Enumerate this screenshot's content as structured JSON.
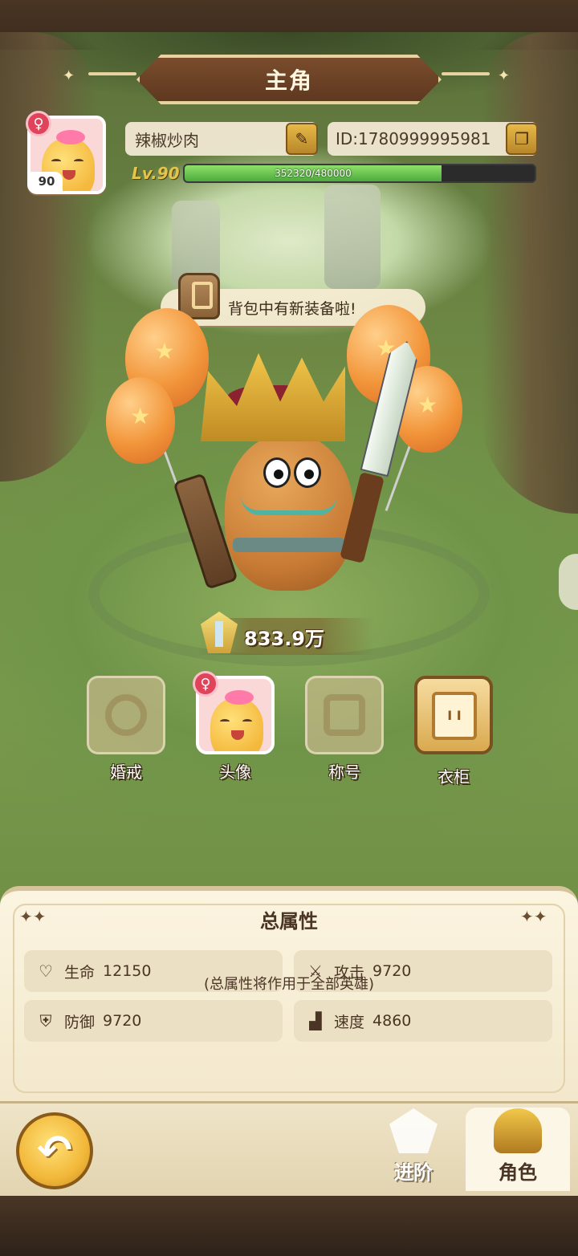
{
  "header": {
    "title": "主角"
  },
  "profile": {
    "name": "辣椒炒肉",
    "id_text": "ID:1780999995981",
    "level_badge": "90",
    "level_label": "Lv.90",
    "xp_text": "352320/480000",
    "xp_current": 352320,
    "xp_max": 480000,
    "gender_icon": "female-icon",
    "edit_icon": "pencil-icon",
    "copy_icon": "copy-icon"
  },
  "notice": {
    "text": "背包中有新装备啦!",
    "icon": "backpack-icon"
  },
  "power": {
    "value": "833.9万",
    "icon": "sword-badge-icon"
  },
  "features": [
    {
      "label": "婚戒",
      "state": "locked",
      "icon": "ring-icon"
    },
    {
      "label": "头像",
      "state": "unlocked",
      "icon": "avatar-icon"
    },
    {
      "label": "称号",
      "state": "locked",
      "icon": "title-crown-icon"
    },
    {
      "label": "衣柜",
      "state": "unlocked",
      "icon": "wardrobe-icon"
    }
  ],
  "attributes": {
    "title": "总属性",
    "stats": [
      {
        "label": "生命",
        "value": "12150",
        "icon": "heart-icon"
      },
      {
        "label": "攻击",
        "value": "9720",
        "icon": "attack-icon"
      },
      {
        "label": "防御",
        "value": "9720",
        "icon": "shield-icon"
      },
      {
        "label": "速度",
        "value": "4860",
        "icon": "boot-icon"
      }
    ],
    "note": "(总属性将作用于全部英雄)"
  },
  "nav": {
    "back_icon": "back-arrow-icon",
    "tabs": [
      {
        "label": "进阶",
        "active": false,
        "icon": "advance-icon"
      },
      {
        "label": "角色",
        "active": true,
        "icon": "character-icon"
      }
    ]
  },
  "colors": {
    "accent_gold": "#e6b948",
    "xp_green": "#5cbf44",
    "badge_red": "#e0445a",
    "panel_bg": "#fbf4e0",
    "text_brown": "#4a3424"
  }
}
